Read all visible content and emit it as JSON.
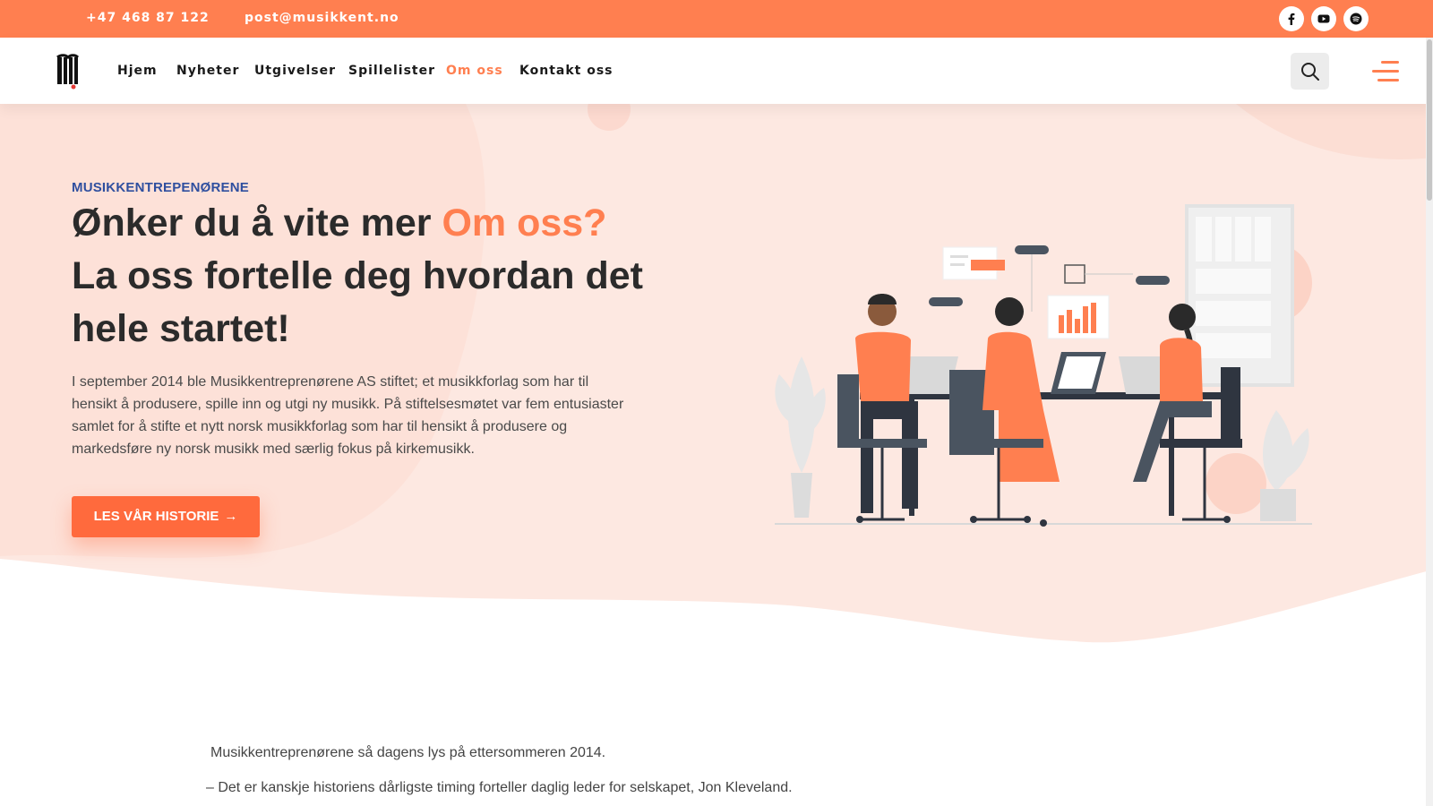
{
  "topbar": {
    "phone": "+47 468 87 122",
    "email": "post@musikkent.no",
    "social": [
      "facebook-icon",
      "youtube-icon",
      "spotify-icon"
    ]
  },
  "nav": {
    "items": [
      {
        "label": "Hjem",
        "active": false
      },
      {
        "label": "Nyheter",
        "active": false
      },
      {
        "label": "Utgivelser",
        "active": false
      },
      {
        "label": "Spillelister",
        "active": false
      },
      {
        "label": "Om oss",
        "active": true
      },
      {
        "label": "Kontakt oss",
        "active": false
      }
    ]
  },
  "hero": {
    "eyebrow": "MUSIKKENTREPENØRENE",
    "headline_part1": "Ønker du å vite mer ",
    "headline_accent": "Om oss?",
    "headline_part2": " La oss fortelle deg hvordan det hele startet!",
    "intro": "I september 2014 ble Musikkentreprenørene AS stiftet; et musikkforlag som har til hensikt å produsere, spille inn og utgi ny musikk. På stiftelsesmøtet var fem entusiaster samlet for å stifte et nytt norsk musikkforlag som har til hensikt å produsere og markedsføre ny norsk musikk med særlig fokus på kirkemusikk.",
    "cta_label": "LES VÅR HISTORIE",
    "cta_arrow": "→"
  },
  "story": {
    "line1": "Musikkentreprenørene så dagens lys på ettersommeren 2014.",
    "line2": "– Det er kanskje historiens dårligste timing forteller daglig leder for selskapet, Jon Kleveland."
  },
  "colors": {
    "accent": "#ff7f50",
    "cta": "#ff6a3d",
    "eyebrow": "#2f4f9f",
    "hero_bg": "#fde8e1"
  }
}
